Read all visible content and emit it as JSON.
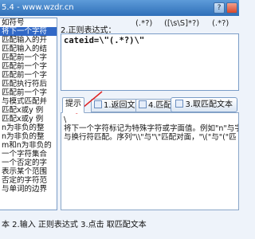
{
  "window": {
    "title": "5.4 - www.wzdr.cn",
    "help_glyph": "?"
  },
  "left_list": {
    "items": [
      "如符号",
      "将下一个字符",
      "匹配输入的开",
      "匹配输入的结",
      "匹配前一个字",
      "匹配前一个字",
      "匹配前一个字",
      "匹配执行符后",
      "匹配前一个字",
      "与模式匹配并",
      "匹配x或y 例",
      "匹配x或y 例",
      "n为非负的整",
      "n为非负的整",
      "m和n为非负的",
      "一个字符集合",
      "一个否定的字",
      "表示某个范围",
      "否定的字符范",
      "与单词的边界"
    ],
    "selected_index": 1
  },
  "regex_panel": {
    "label": "2.正则表达式：",
    "quick_inserts": [
      "(.*?)",
      "([\\s\\S]*?)",
      "(.*?)"
    ],
    "pattern": "cateid=\\\"(.*?)\\\""
  },
  "tabs": [
    {
      "label": "提示",
      "active": true
    },
    {
      "label": "1.返回文本",
      "active": false
    },
    {
      "label": "4.匹配结果",
      "active": false
    }
  ],
  "match_button": {
    "label": "3.取匹配文本"
  },
  "hint": {
    "lines": [
      "\\",
      "将下一个字符标记为特殊字符或字面值。例如\"n\"与字符\"n\"",
      "与换行符匹配。序列\"\\\\\"与\"\\\"匹配对面，\"\\(\"与\"(\"匹"
    ]
  },
  "status": {
    "text": "本 2.输入 正则表达式 3.点击 取匹配文本"
  }
}
